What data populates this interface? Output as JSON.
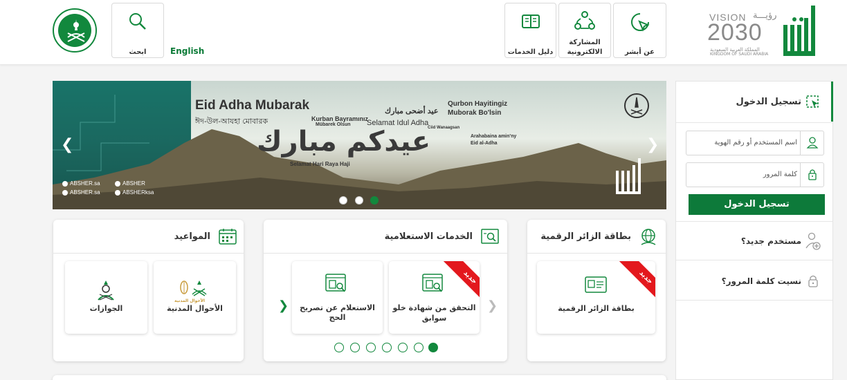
{
  "header": {
    "english_link": "English",
    "search_label": "ابحث",
    "services_guide_label": "دليل الخدمات",
    "eparticipation_label_1": "المشاركة",
    "eparticipation_label_2": "الالكترونية",
    "about_label": "عن أبشر",
    "vision_text": "VISION",
    "vision_arabic": "رؤيـــة",
    "vision_year": "2030",
    "vision_kingdom_ar": "المملكة العربية السعودية",
    "vision_kingdom_en": "KINGDOM OF SAUDI ARABIA"
  },
  "banner": {
    "title": "Eid Adha Mubarak",
    "line_kurban": "Kurban Bayramınız",
    "line_mubarek": "Mübarek Olsun",
    "line_arabic_small": "عيد أضحى مبارك",
    "line_selamat_idul": "Selamat Idul Adha",
    "line_qurbon": "Qurbon Hayitingiz",
    "line_muborak": "Muborak Bo'lsin",
    "line_bengali": "ঈদ-উল-আযহা মোবারক",
    "line_cild": "Ciid Wanaagsan",
    "line_arahabaina": "Arahabaina amin'ny",
    "line_eid": "Eid al-Adha",
    "big_arabic": "عيدكم مبارك",
    "line_selamat_hari": "Selamat Hari Raya Haji",
    "social": [
      "ABSHER.sa",
      "ABSHER",
      "ABSHER.sa",
      "ABSHERksa"
    ]
  },
  "cards": {
    "appointments_title": "المواعيد",
    "inquiry_title": "الخدمات الاستعلامية",
    "visitor_title": "بطاقة الزائر الرقمية",
    "tile_passports": "الجوازات",
    "tile_civil": "الأحوال المدنية",
    "tile_civil_logo": "الأحوال المدنية",
    "tile_hajj": "الاستعلام عن تصريح الحج",
    "tile_verify_1": "التحقق من شهادة خلو",
    "tile_verify_2": "سوابق",
    "tile_visitor": "بطاقة الزائر الرقمية",
    "ribbon": "جديد"
  },
  "login": {
    "title": "تسجيل الدخول",
    "username_placeholder": "اسم المستخدم أو رقم الهوية",
    "password_placeholder": "كلمة المرور",
    "button": "تسجيل الدخول",
    "new_user": "مستخدم جديد؟",
    "forgot": "نسيت كلمة المرور؟"
  },
  "colors": {
    "primary": "#0d7a3a",
    "ribbon": "#e3181d"
  }
}
